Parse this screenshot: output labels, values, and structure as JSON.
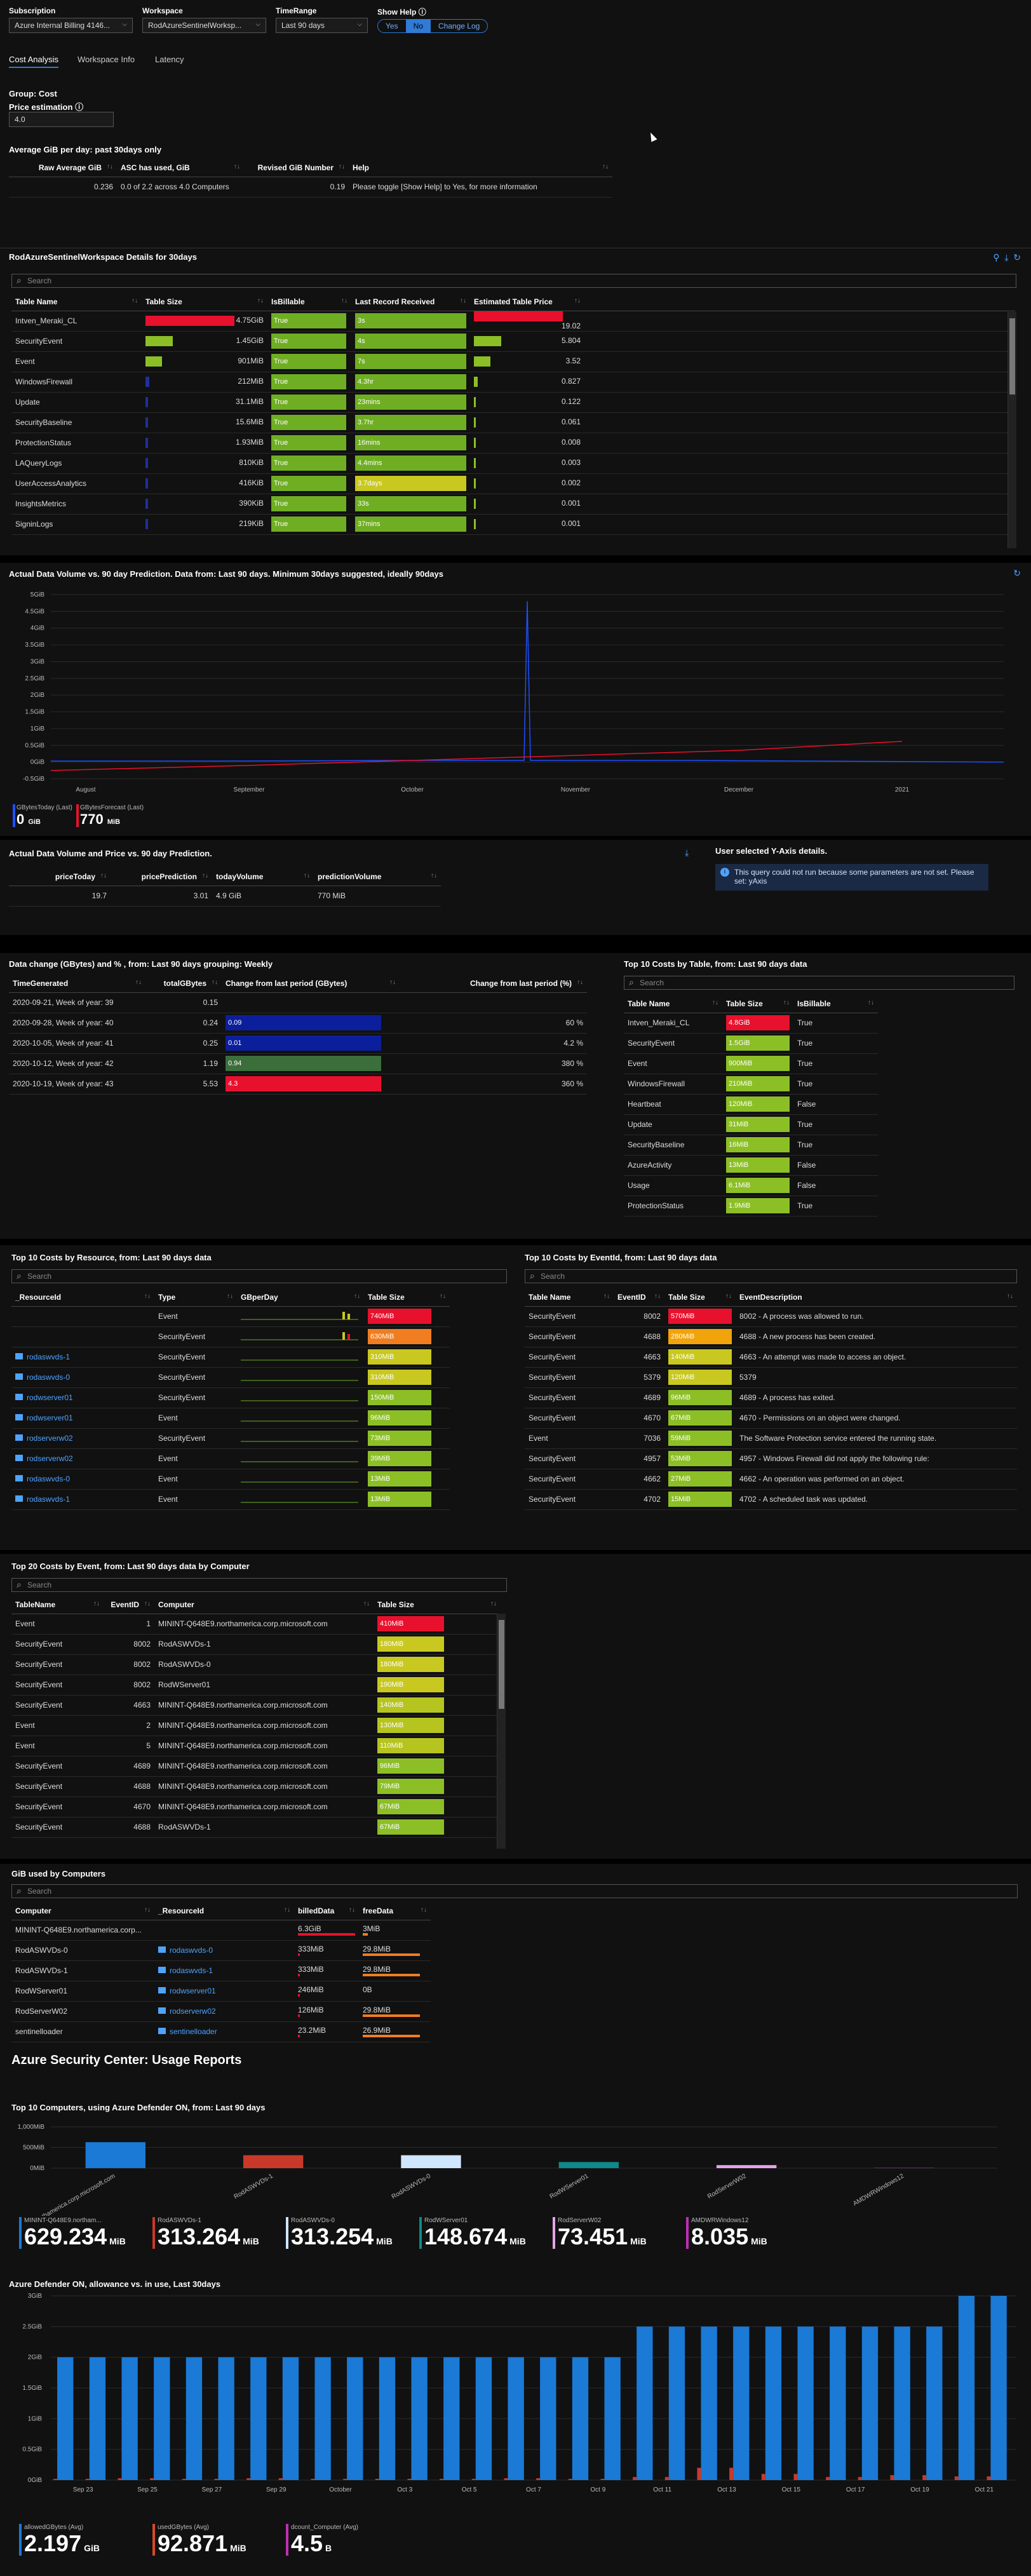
{
  "params": {
    "subscription_label": "Subscription",
    "subscription_value": "Azure Internal Billing 4146...",
    "workspace_label": "Workspace",
    "workspace_value": "RodAzureSentinelWorksp...",
    "timerange_label": "TimeRange",
    "timerange_value": "Last 90 days",
    "showhelp_label": "Show Help",
    "yes": "Yes",
    "no": "No",
    "changelog": "Change Log"
  },
  "tabs": [
    "Cost Analysis",
    "Workspace Info",
    "Latency"
  ],
  "cost": {
    "group_label": "Group: Cost",
    "price_label": "Price estimation",
    "price_value": "4.0"
  },
  "avg": {
    "title": "Average GiB per day: past 30days only",
    "headers": [
      "Raw Average GiB",
      "ASC has used, GiB",
      "Revised GiB Number",
      "Help"
    ],
    "row": [
      "0.236",
      "0.0 of 2.2 across 4.0 Computers",
      "0.19",
      "Please toggle [Show Help] to Yes, for more information"
    ]
  },
  "details": {
    "title": "RodAzureSentinelWorkspace Details for 30days",
    "search": "Search",
    "headers": [
      "Table Name",
      "Table Size",
      "IsBillable",
      "Last Record Received",
      "Estimated Table Price"
    ],
    "rows": [
      [
        "Intven_Meraki_CL",
        "4.75GiB",
        "True",
        "3s",
        "19.02"
      ],
      [
        "SecurityEvent",
        "1.45GiB",
        "True",
        "4s",
        "5.804"
      ],
      [
        "Event",
        "901MiB",
        "True",
        "7s",
        "3.52"
      ],
      [
        "WindowsFirewall",
        "212MiB",
        "True",
        "4.3hr",
        "0.827"
      ],
      [
        "Update",
        "31.1MiB",
        "True",
        "23mins",
        "0.122"
      ],
      [
        "SecurityBaseline",
        "15.6MiB",
        "True",
        "3.7hr",
        "0.061"
      ],
      [
        "ProtectionStatus",
        "1.93MiB",
        "True",
        "16mins",
        "0.008"
      ],
      [
        "LAQueryLogs",
        "810KiB",
        "True",
        "4.4mins",
        "0.003"
      ],
      [
        "UserAccessAnalytics",
        "416KiB",
        "True",
        "3.7days",
        "0.002"
      ],
      [
        "InsightsMetrics",
        "390KiB",
        "True",
        "33s",
        "0.001"
      ],
      [
        "SigninLogs",
        "219KiB",
        "True",
        "37mins",
        "0.001"
      ]
    ]
  },
  "volume": {
    "title": "Actual Data Volume vs. 90 day Prediction. Data from: Last 90 days. Minimum 30days suggested, ideally 90days",
    "ticks": [
      "5GiB",
      "4.5GiB",
      "4GiB",
      "3.5GiB",
      "3GiB",
      "2.5GiB",
      "2GiB",
      "1.5GiB",
      "1GiB",
      "0.5GiB",
      "0GiB",
      "-0.5GiB"
    ],
    "xticks": [
      "August",
      "September",
      "October",
      "November",
      "December",
      "2021"
    ],
    "tile1_label": "GBytesToday (Last)",
    "tile1_value": "0",
    "tile1_unit": "GiB",
    "tile2_label": "GBytesForecast (Last)",
    "tile2_value": "770",
    "tile2_unit": "MiB",
    "colors": {
      "actual": "#1f4fff",
      "forecast": "#e8112d"
    }
  },
  "chart_data": [
    {
      "type": "line",
      "title": "Actual Data Volume vs. 90 day Prediction. Data from: Last 90 days. Minimum 30days suggested, ideally 90days",
      "ylim": [
        -0.5,
        5
      ],
      "x": [
        "August",
        "September",
        "October",
        "November",
        "December",
        "2021"
      ],
      "series": [
        {
          "name": "GBytesToday",
          "values": [
            0.03,
            0.03,
            0.05,
            4.8,
            0.05,
            0
          ]
        },
        {
          "name": "GBytesForecast",
          "values": [
            -0.25,
            -0.1,
            0.05,
            0.2,
            0.35,
            0.62
          ]
        }
      ]
    },
    {
      "type": "bar",
      "title": "Top 10 Computers, using Azure Defender ON, from: Last 90 days",
      "ylabel": "",
      "ylim": [
        0,
        1000
      ],
      "categories": [
        "MININT-Q648E9.northamerica.corp.microsoft.com",
        "RodASWVDs-1",
        "RodASWVDs-0",
        "RodWServer01",
        "RodServerW02",
        "AMDWRWindows12"
      ],
      "values": [
        629.234,
        313.264,
        313.254,
        148.674,
        73.451,
        8.035
      ]
    },
    {
      "type": "bar",
      "title": "Azure Defender ON, allowance vs. in use, Last 30days",
      "ylim": [
        0,
        3
      ],
      "categories": [
        "Sep 23",
        "Sep 25",
        "Sep 27",
        "Sep 29",
        "October",
        "Oct 3",
        "Oct 5",
        "Oct 7",
        "Oct 9",
        "Oct 11",
        "Oct 13",
        "Oct 15",
        "Oct 17",
        "Oct 19",
        "Oct 21"
      ],
      "series": [
        {
          "name": "allowedGBytes",
          "values": [
            2,
            2,
            2,
            2,
            2,
            2,
            2,
            2,
            2,
            2.5,
            2.5,
            2.5,
            2.5,
            2.5,
            3
          ]
        },
        {
          "name": "usedGBytes",
          "values": [
            0.02,
            0.03,
            0.02,
            0.03,
            0.02,
            0.02,
            0.02,
            0.03,
            0.02,
            0.05,
            0.2,
            0.1,
            0.05,
            0.08,
            0.06
          ]
        }
      ]
    }
  ],
  "price": {
    "title": "Actual Data Volume and Price vs. 90 day Prediction.",
    "headers": [
      "priceToday",
      "pricePrediction",
      "todayVolume",
      "predictionVolume"
    ],
    "row": [
      "19.7",
      "3.01",
      "4.9 GiB",
      "770 MiB"
    ],
    "yaxis_title": "User selected Y-Axis details.",
    "notice": "This query could not run because some parameters are not set. Please set: yAxis"
  },
  "change": {
    "title": "Data change (GBytes) and % , from: Last 90 days grouping: Weekly",
    "headers": [
      "TimeGenerated",
      "totalGBytes",
      "Change from last period (GBytes)",
      "Change from last period (%)"
    ],
    "rows": [
      [
        "2020-09-21, Week of year: 39",
        "0.15",
        "",
        "",
        ""
      ],
      [
        "2020-09-28, Week of year: 40",
        "0.24",
        "0.09",
        "60 %"
      ],
      [
        "2020-10-05, Week of year: 41",
        "0.25",
        "0.01",
        "4.2 %"
      ],
      [
        "2020-10-12, Week of year: 42",
        "1.19",
        "0.94",
        "380 %"
      ],
      [
        "2020-10-19, Week of year: 43",
        "5.53",
        "4.3",
        "360 %"
      ]
    ]
  },
  "top10table": {
    "title": "Top 10 Costs by Table, from: Last 90 days data",
    "search": "Search",
    "headers": [
      "Table Name",
      "Table Size",
      "IsBillable"
    ],
    "rows": [
      [
        "Intven_Meraki_CL",
        "4.8GiB",
        "True"
      ],
      [
        "SecurityEvent",
        "1.5GiB",
        "True"
      ],
      [
        "Event",
        "900MiB",
        "True"
      ],
      [
        "WindowsFirewall",
        "210MiB",
        "True"
      ],
      [
        "Heartbeat",
        "120MiB",
        "False"
      ],
      [
        "Update",
        "31MiB",
        "True"
      ],
      [
        "SecurityBaseline",
        "16MiB",
        "True"
      ],
      [
        "AzureActivity",
        "13MiB",
        "False"
      ],
      [
        "Usage",
        "6.1MiB",
        "False"
      ],
      [
        "ProtectionStatus",
        "1.9MiB",
        "True"
      ]
    ]
  },
  "top10res": {
    "title": "Top 10 Costs by Resource, from: Last 90 days data",
    "search": "Search",
    "headers": [
      "_ResourceId",
      "Type",
      "GBperDay",
      "Table Size"
    ],
    "rows": [
      [
        "",
        "Event",
        "740MiB"
      ],
      [
        "",
        "SecurityEvent",
        "630MiB"
      ],
      [
        "rodaswvds-1",
        "SecurityEvent",
        "310MiB"
      ],
      [
        "rodaswvds-0",
        "SecurityEvent",
        "310MiB"
      ],
      [
        "rodwserver01",
        "SecurityEvent",
        "150MiB"
      ],
      [
        "rodwserver01",
        "Event",
        "96MiB"
      ],
      [
        "rodserverw02",
        "SecurityEvent",
        "73MiB"
      ],
      [
        "rodserverw02",
        "Event",
        "39MiB"
      ],
      [
        "rodaswvds-0",
        "Event",
        "13MiB"
      ],
      [
        "rodaswvds-1",
        "Event",
        "13MiB"
      ]
    ]
  },
  "top10event": {
    "title": "Top 10 Costs by EventId, from: Last 90 days data",
    "search": "Search",
    "headers": [
      "Table Name",
      "EventID",
      "Table Size",
      "EventDescription"
    ],
    "rows": [
      [
        "SecurityEvent",
        "8002",
        "570MiB",
        "8002 - A process was allowed to run."
      ],
      [
        "SecurityEvent",
        "4688",
        "280MiB",
        "4688 - A new process has been created."
      ],
      [
        "SecurityEvent",
        "4663",
        "140MiB",
        "4663 - An attempt was made to access an object."
      ],
      [
        "SecurityEvent",
        "5379",
        "120MiB",
        "5379"
      ],
      [
        "SecurityEvent",
        "4689",
        "96MiB",
        "4689 - A process has exited."
      ],
      [
        "SecurityEvent",
        "4670",
        "67MiB",
        "4670 - Permissions on an object were changed."
      ],
      [
        "Event",
        "7036",
        "59MiB",
        "The Software Protection service entered the running state."
      ],
      [
        "SecurityEvent",
        "4957",
        "53MiB",
        "4957 - Windows Firewall did not apply the following rule:"
      ],
      [
        "SecurityEvent",
        "4662",
        "27MiB",
        "4662 - An operation was performed on an object."
      ],
      [
        "SecurityEvent",
        "4702",
        "15MiB",
        "4702 - A scheduled task was updated."
      ]
    ]
  },
  "top20": {
    "title": "Top 20 Costs by Event, from: Last 90 days data by Computer",
    "search": "Search",
    "headers": [
      "TableName",
      "EventID",
      "Computer",
      "Table Size"
    ],
    "rows": [
      [
        "Event",
        "1",
        "MININT-Q648E9.northamerica.corp.microsoft.com",
        "410MiB"
      ],
      [
        "SecurityEvent",
        "8002",
        "RodASWVDs-1",
        "180MiB"
      ],
      [
        "SecurityEvent",
        "8002",
        "RodASWVDs-0",
        "180MiB"
      ],
      [
        "SecurityEvent",
        "8002",
        "RodWServer01",
        "190MiB"
      ],
      [
        "SecurityEvent",
        "4663",
        "MININT-Q648E9.northamerica.corp.microsoft.com",
        "140MiB"
      ],
      [
        "Event",
        "2",
        "MININT-Q648E9.northamerica.corp.microsoft.com",
        "130MiB"
      ],
      [
        "Event",
        "5",
        "MININT-Q648E9.northamerica.corp.microsoft.com",
        "110MiB"
      ],
      [
        "SecurityEvent",
        "4689",
        "MININT-Q648E9.northamerica.corp.microsoft.com",
        "96MiB"
      ],
      [
        "SecurityEvent",
        "4688",
        "MININT-Q648E9.northamerica.corp.microsoft.com",
        "79MiB"
      ],
      [
        "SecurityEvent",
        "4670",
        "MININT-Q648E9.northamerica.corp.microsoft.com",
        "67MiB"
      ],
      [
        "SecurityEvent",
        "4688",
        "RodASWVDs-1",
        "67MiB"
      ]
    ]
  },
  "computers": {
    "title": "GiB used by Computers",
    "search": "Search",
    "headers": [
      "Computer",
      "_ResourceId",
      "billedData",
      "freeData"
    ],
    "rows": [
      [
        "MININT-Q648E9.northamerica.corp...",
        "",
        "6.3GiB",
        "3MiB"
      ],
      [
        "RodASWVDs-0",
        "rodaswvds-0",
        "333MiB",
        "29.8MiB"
      ],
      [
        "RodASWVDs-1",
        "rodaswvds-1",
        "333MiB",
        "29.8MiB"
      ],
      [
        "RodWServer01",
        "rodwserver01",
        "246MiB",
        "0B"
      ],
      [
        "RodServerW02",
        "rodserverw02",
        "126MiB",
        "29.8MiB"
      ],
      [
        "sentinelloader",
        "sentinelloader",
        "23.2MiB",
        "26.9MiB"
      ]
    ]
  },
  "asc": {
    "heading": "Azure Security Center: Usage Reports",
    "top10_title": "Top 10 Computers, using Azure Defender ON, from: Last 90 days",
    "yticks": [
      "1,000MiB",
      "500MiB",
      "0MiB"
    ],
    "tiles": [
      {
        "label": "MININT-Q648E9.northam...",
        "value": "629.234",
        "unit": "MiB",
        "color": "#1a7ad6"
      },
      {
        "label": "RodASWVDs-1",
        "value": "313.264",
        "unit": "MiB",
        "color": "#c9392a"
      },
      {
        "label": "RodASWVDs-0",
        "value": "313.254",
        "unit": "MiB",
        "color": "#cfe6ff"
      },
      {
        "label": "RodWServer01",
        "value": "148.674",
        "unit": "MiB",
        "color": "#0e8a8a"
      },
      {
        "label": "RodServerW02",
        "value": "73.451",
        "unit": "MiB",
        "color": "#e3a6e6"
      },
      {
        "label": "AMDWRWindows12",
        "value": "8.035",
        "unit": "MiB",
        "color": "#c02eb5"
      }
    ],
    "allow_title": "Azure Defender ON, allowance vs. in use, Last 30days",
    "allow_yticks": [
      "3GiB",
      "2.5GiB",
      "2GiB",
      "1.5GiB",
      "1GiB",
      "0.5GiB",
      "0GiB"
    ],
    "allow_tiles": [
      {
        "label": "allowedGBytes (Avg)",
        "value": "2.197",
        "unit": "GiB",
        "color": "#1a7ad6"
      },
      {
        "label": "usedGBytes (Avg)",
        "value": "92.871",
        "unit": "MiB",
        "color": "#d84a2a"
      },
      {
        "label": "dcount_Computer (Avg)",
        "value": "4.5",
        "unit": "B",
        "color": "#c02eb5"
      }
    ]
  }
}
